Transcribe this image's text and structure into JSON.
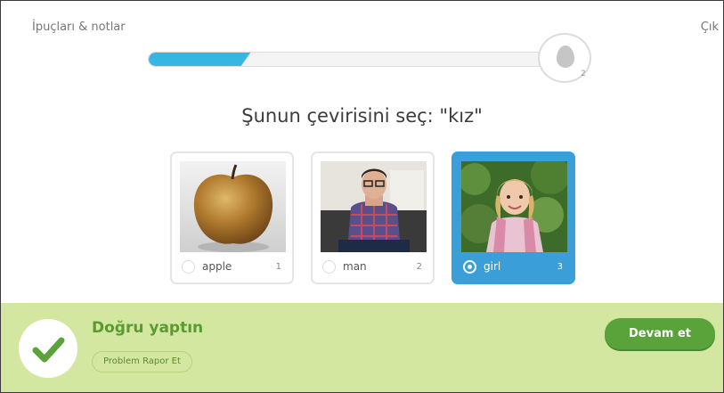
{
  "header": {
    "hints_label": "İpuçları & notlar",
    "quit_label": "Çık",
    "progress_fraction": 0.22,
    "lingot_count": "2"
  },
  "question": {
    "prompt": "Şunun çevirisini seç: \"kız\""
  },
  "options": [
    {
      "label": "apple",
      "number": "1",
      "selected": false,
      "image_subject": "apple"
    },
    {
      "label": "man",
      "number": "2",
      "selected": false,
      "image_subject": "man"
    },
    {
      "label": "girl",
      "number": "3",
      "selected": true,
      "image_subject": "girl"
    }
  ],
  "footer": {
    "result_title": "Doğru yaptın",
    "report_label": "Problem Rapor Et",
    "continue_label": "Devam et"
  },
  "colors": {
    "progress": "#35b6e3",
    "selected_card": "#3a9fd8",
    "footer_bg": "#d3e7a1",
    "success": "#5aa33a"
  },
  "icons": {
    "lingot": "egg-icon",
    "correct": "checkmark-icon",
    "radio": "radio-icon"
  }
}
